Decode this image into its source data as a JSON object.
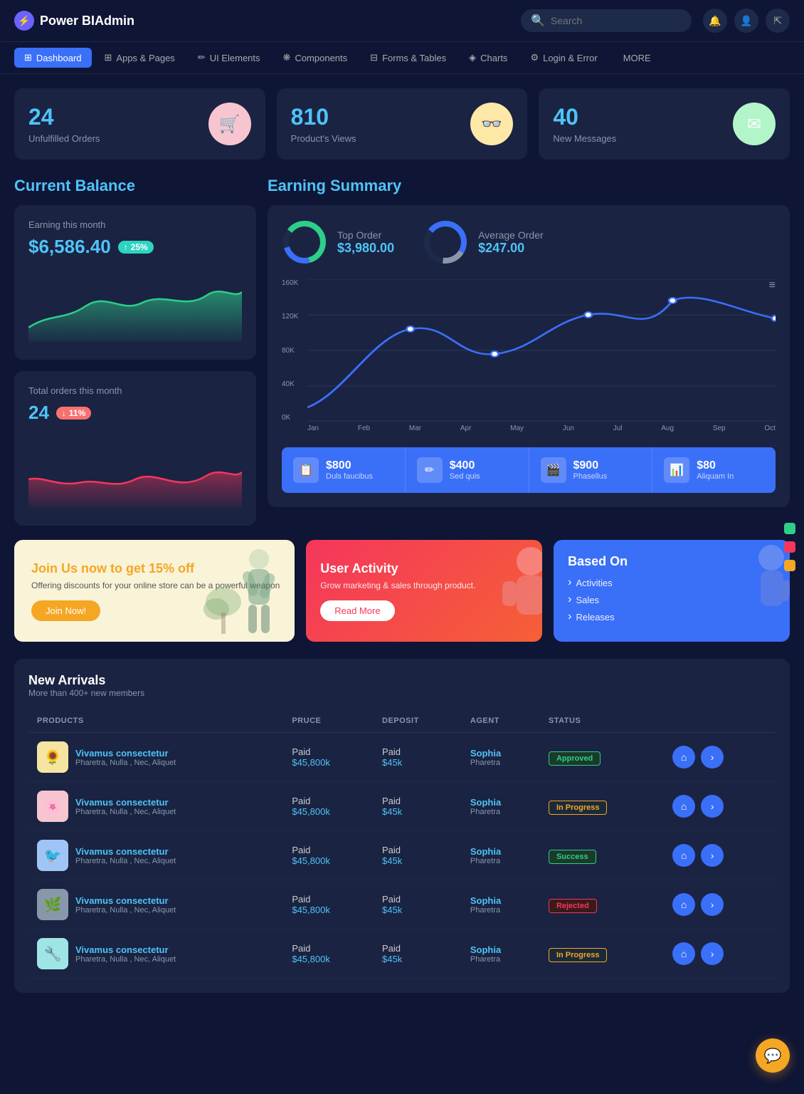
{
  "app": {
    "name": "Power BIAdmin",
    "logo_icon": "⚡"
  },
  "header": {
    "search_placeholder": "Search",
    "icons": [
      "🔔",
      "👤",
      "🔗"
    ]
  },
  "nav": {
    "items": [
      {
        "label": "Dashboard",
        "icon": "⊞",
        "active": true
      },
      {
        "label": "Apps & Pages",
        "icon": "⊞",
        "active": false
      },
      {
        "label": "UI Elements",
        "icon": "✏",
        "active": false
      },
      {
        "label": "Components",
        "icon": "❋",
        "active": false
      },
      {
        "label": "Forms & Tables",
        "icon": "⊟",
        "active": false
      },
      {
        "label": "Charts",
        "icon": "◈",
        "active": false
      },
      {
        "label": "Login & Error",
        "icon": "⚙",
        "active": false
      },
      {
        "label": "MORE",
        "active": false
      }
    ]
  },
  "stat_cards": [
    {
      "value": "24",
      "label": "Unfulfilled Orders",
      "icon": "🛒",
      "icon_bg": "pink"
    },
    {
      "value": "810",
      "label": "Product's Views",
      "icon": "👓",
      "icon_bg": "yellow"
    },
    {
      "value": "40",
      "label": "New Messages",
      "icon": "✉",
      "icon_bg": "green"
    }
  ],
  "current_balance": {
    "title": "Current Balance",
    "earning_label": "Earning this month",
    "earning_amount": "$6,586.40",
    "earning_pct": "25%",
    "total_orders_label": "Total orders this month",
    "total_orders_value": "24",
    "total_orders_pct": "11%"
  },
  "earning_summary": {
    "title": "Earning Summary",
    "top_order_label": "Top Order",
    "top_order_value": "$3,980.00",
    "avg_order_label": "Average Order",
    "avg_order_value": "$247.00",
    "chart_y_labels": [
      "160K",
      "120K",
      "80K",
      "40K",
      "0K"
    ],
    "chart_x_labels": [
      "Jan",
      "Feb",
      "Mar",
      "Apr",
      "May",
      "Jun",
      "Jul",
      "Aug",
      "Sep",
      "Oct"
    ],
    "bottom_stats": [
      {
        "icon": "📋",
        "value": "$800",
        "label": "Duls faucibus"
      },
      {
        "icon": "✏",
        "value": "$400",
        "label": "Sed quis"
      },
      {
        "icon": "🎬",
        "value": "$900",
        "label": "Phasellus"
      },
      {
        "icon": "📊",
        "value": "$80",
        "label": "Aliquam In"
      }
    ]
  },
  "promos": {
    "join": {
      "title": "Join Us now to get 15% off",
      "desc": "Offering discounts for your online store can be a powerful weapon",
      "btn": "Join Now!"
    },
    "activity": {
      "title": "User Activity",
      "desc": "Grow marketing & sales through product.",
      "btn": "Read More"
    },
    "based": {
      "title": "Based On",
      "items": [
        "Activities",
        "Sales",
        "Releases"
      ]
    }
  },
  "new_arrivals": {
    "title": "New Arrivals",
    "subtitle": "More than 400+ new members",
    "columns": [
      "PRODUCTS",
      "PRUCE",
      "DEPOSIT",
      "AGENT",
      "STATUS",
      ""
    ],
    "rows": [
      {
        "thumb_emoji": "🌻",
        "thumb_class": "thumb-yellow",
        "name": "Vivamus consectetur",
        "desc": "Pharetra, Nulla , Nec, Aliquet",
        "price": "Paid",
        "price_sub": "$45,800k",
        "deposit": "Paid",
        "deposit_sub": "$45k",
        "agent": "Sophia",
        "agent_sub": "Pharetra",
        "status": "Approved",
        "status_class": "status-approved"
      },
      {
        "thumb_emoji": "🌸",
        "thumb_class": "thumb-pink",
        "name": "Vivamus consectetur",
        "desc": "Pharetra, Nulla , Nec, Aliquet",
        "price": "Paid",
        "price_sub": "$45,800k",
        "deposit": "Paid",
        "deposit_sub": "$45k",
        "agent": "Sophia",
        "agent_sub": "Pharetra",
        "status": "In Progress",
        "status_class": "status-inprogress"
      },
      {
        "thumb_emoji": "🐦",
        "thumb_class": "thumb-blue",
        "name": "Vivamus consectetur",
        "desc": "Pharetra, Nulla , Nec, Aliquet",
        "price": "Paid",
        "price_sub": "$45,800k",
        "deposit": "Paid",
        "deposit_sub": "$45k",
        "agent": "Sophia",
        "agent_sub": "Pharetra",
        "status": "Success",
        "status_class": "status-success"
      },
      {
        "thumb_emoji": "🌿",
        "thumb_class": "thumb-gray",
        "name": "Vivamus consectetur",
        "desc": "Pharetra, Nulla , Nec, Aliquet",
        "price": "Paid",
        "price_sub": "$45,800k",
        "deposit": "Paid",
        "deposit_sub": "$45k",
        "agent": "Sophia",
        "agent_sub": "Pharetra",
        "status": "Rejected",
        "status_class": "status-rejected"
      },
      {
        "thumb_emoji": "🔧",
        "thumb_class": "thumb-teal",
        "name": "Vivamus consectetur",
        "desc": "Pharetra, Nulla , Nec, Aliquet",
        "price": "Paid",
        "price_sub": "$45,800k",
        "deposit": "Paid",
        "deposit_sub": "$45k",
        "agent": "Sophia",
        "agent_sub": "Pharetra",
        "status": "In Progress",
        "status_class": "status-inprogress"
      }
    ]
  },
  "side_dots": [
    {
      "color": "green"
    },
    {
      "color": "red"
    },
    {
      "color": "yellow"
    }
  ],
  "fab_icon": "💬"
}
